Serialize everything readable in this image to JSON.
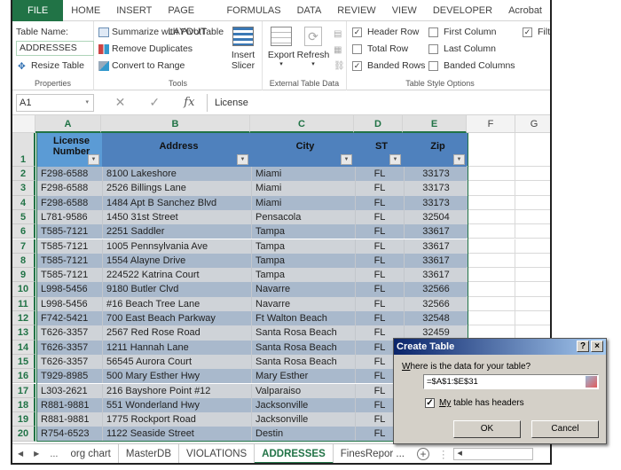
{
  "ribbon_tabs": [
    "FILE",
    "HOME",
    "INSERT",
    "PAGE LAYOUT",
    "FORMULAS",
    "DATA",
    "REVIEW",
    "VIEW",
    "DEVELOPER",
    "Acrobat"
  ],
  "properties": {
    "table_name_label": "Table Name:",
    "table_name_value": "ADDRESSES",
    "resize_label": "Resize Table",
    "group_label": "Properties"
  },
  "tools": {
    "summarize_label": "Summarize with PivotTable",
    "remove_dup_label": "Remove Duplicates",
    "convert_label": "Convert to Range",
    "slicer_line1": "Insert",
    "slicer_line2": "Slicer",
    "group_label": "Tools"
  },
  "external": {
    "export_label": "Export",
    "refresh_label": "Refresh",
    "group_label": "External Table Data"
  },
  "style_options": {
    "group_label": "Table Style Options",
    "options": [
      {
        "label": "Header Row",
        "checked": true
      },
      {
        "label": "Total Row",
        "checked": false
      },
      {
        "label": "Banded Rows",
        "checked": true
      },
      {
        "label": "First Column",
        "checked": false
      },
      {
        "label": "Last Column",
        "checked": false
      },
      {
        "label": "Banded Columns",
        "checked": false
      },
      {
        "label": "Filter B",
        "checked": true
      }
    ]
  },
  "formula_bar": {
    "name_box": "A1",
    "fx": "fx",
    "value": "License"
  },
  "columns": [
    "A",
    "B",
    "C",
    "D",
    "E",
    "F",
    "G"
  ],
  "table": {
    "headers": [
      "License Number",
      "Address",
      "City",
      "ST",
      "Zip"
    ],
    "header_line1": "License",
    "header_line2": "Number",
    "rows": [
      [
        "F298-6588",
        "8100 Lakeshore",
        "Miami",
        "FL",
        "33173"
      ],
      [
        "F298-6588",
        "2526 Billings Lane",
        "Miami",
        "FL",
        "33173"
      ],
      [
        "F298-6588",
        "1484 Apt B Sanchez Blvd",
        "Miami",
        "FL",
        "33173"
      ],
      [
        "L781-9586",
        "1450 31st Street",
        "Pensacola",
        "FL",
        "32504"
      ],
      [
        "T585-7121",
        "2251 Saddler",
        "Tampa",
        "FL",
        "33617"
      ],
      [
        "T585-7121",
        "1005 Pennsylvania Ave",
        "Tampa",
        "FL",
        "33617"
      ],
      [
        "T585-7121",
        "1554 Alayne Drive",
        "Tampa",
        "FL",
        "33617"
      ],
      [
        "T585-7121",
        "224522 Katrina Court",
        "Tampa",
        "FL",
        "33617"
      ],
      [
        "L998-5456",
        "9180 Butler Clvd",
        "Navarre",
        "FL",
        "32566"
      ],
      [
        "L998-5456",
        "#16 Beach Tree Lane",
        "Navarre",
        "FL",
        "32566"
      ],
      [
        "F742-5421",
        "700 East Beach Parkway",
        "Ft Walton Beach",
        "FL",
        "32548"
      ],
      [
        "T626-3357",
        "2567 Red Rose Road",
        "Santa Rosa Beach",
        "FL",
        "32459"
      ],
      [
        "T626-3357",
        "1211 Hannah Lane",
        "Santa Rosa Beach",
        "FL",
        ""
      ],
      [
        "T626-3357",
        "56545 Aurora Court",
        "Santa Rosa Beach",
        "FL",
        ""
      ],
      [
        "T929-8985",
        "500 Mary Esther Hwy",
        "Mary Esther",
        "FL",
        ""
      ],
      [
        "L303-2621",
        "216 Bayshore Point #12",
        "Valparaiso",
        "FL",
        ""
      ],
      [
        "R881-9881",
        "551 Wonderland Hwy",
        "Jacksonville",
        "FL",
        ""
      ],
      [
        "R881-9881",
        "1775 Rockport Road",
        "Jacksonville",
        "FL",
        ""
      ],
      [
        "R754-6523",
        "1122 Seaside Street",
        "Destin",
        "FL",
        ""
      ]
    ]
  },
  "sheet_tabs": [
    "org chart",
    "MasterDB",
    "VIOLATIONS",
    "ADDRESSES",
    "FinesRepor ..."
  ],
  "active_sheet": "ADDRESSES",
  "dialog": {
    "title": "Create Table",
    "help": "?",
    "close": "×",
    "question": "Where is the data for your table?",
    "range": "=$A$1:$E$31",
    "headers_checkbox_label": "My table has headers",
    "headers_checked": true,
    "ok": "OK",
    "cancel": "Cancel"
  },
  "colors": {
    "excel_green": "#217346",
    "table_header": "#4f81bd",
    "band_dark": "#a9b9cc",
    "band_light": "#cfd3d8"
  }
}
